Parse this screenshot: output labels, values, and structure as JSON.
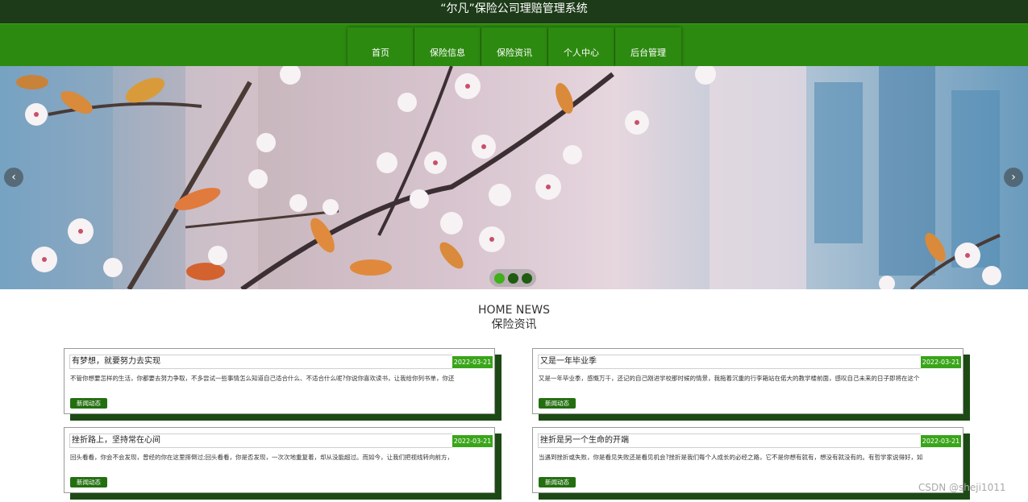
{
  "header": {
    "title": "“尔凡”保险公司理赔管理系统"
  },
  "nav": {
    "items": [
      {
        "label": "首页"
      },
      {
        "label": "保险信息"
      },
      {
        "label": "保险资讯"
      },
      {
        "label": "个人中心"
      },
      {
        "label": "后台管理"
      }
    ]
  },
  "banner": {
    "prev_icon": "chevron-left-icon",
    "prev_glyph": "‹",
    "next_icon": "chevron-right-icon",
    "next_glyph": "›",
    "slide_count": 3,
    "active_slide": 1
  },
  "news": {
    "heading_en": "HOME NEWS",
    "heading_cn": "保险资讯",
    "cards": [
      {
        "title": "有梦想，就要努力去实现",
        "date": "2022-03-21",
        "desc": "不管你想要怎样的生活，你都要去努力争取，不多尝试一些事情怎么知道自己适合什么、不适合什么呢?你说你喜欢读书，让我给你列书单，你还",
        "tag": "新闻动态"
      },
      {
        "title": "又是一年毕业季",
        "date": "2022-03-21",
        "desc": "又是一年毕业季，感慨万千，还记的自己刚进学校那时候的情景，我拖着沉重的行李箱站在偌大的教学楼前面，感叹自己未来的日子即将在这个",
        "tag": "新闻动态"
      },
      {
        "title": "挫折路上，坚持常在心间",
        "date": "2022-03-21",
        "desc": "回头看看，你会不会发现，曾经的你在这里摔倒过;回头看看，你是否发现，一次次地重复着，却从没能超过。而如今，让我们把视线转向前方，",
        "tag": "新闻动态"
      },
      {
        "title": "挫折是另一个生命的开端",
        "date": "2022-03-21",
        "desc": "当遇到挫折或失败，你是看见失败还是看见机会?挫折是我们每个人成长的必经之路，它不是你想有就有，想没有就没有的。有哲学家说得好，如",
        "tag": "新闻动态"
      }
    ]
  },
  "watermark": "CSDN @sheji1011",
  "colors": {
    "title_bar": "#1d3a19",
    "nav": "#2d8a10",
    "date_badge": "#3aa51a",
    "tag": "#236f10",
    "card_shadow": "#1d4a14"
  }
}
